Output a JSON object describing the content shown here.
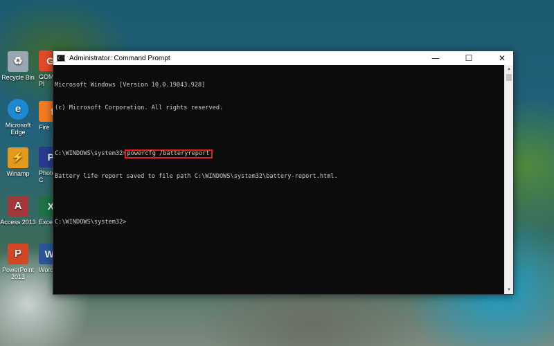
{
  "desktop": {
    "icons": [
      {
        "name": "recycle-bin",
        "label": "Recycle Bin",
        "glyph": "♻",
        "color": "#9aa7b3"
      },
      {
        "name": "microsoft-edge",
        "label": "Microsoft Edge",
        "glyph": "e",
        "color": "#1b8ad3"
      },
      {
        "name": "winamp",
        "label": "Winamp",
        "glyph": "⚡",
        "color": "#e59a1e"
      },
      {
        "name": "access-2013",
        "label": "Access 2013",
        "glyph": "A",
        "color": "#a4373a"
      },
      {
        "name": "powerpoint-2013",
        "label": "PowerPoint 2013",
        "glyph": "P",
        "color": "#d24726"
      }
    ],
    "partial_icons": [
      {
        "name": "gom-player",
        "label": "GOM",
        "label2": "Pl",
        "glyph": "G",
        "color": "#e14b2a"
      },
      {
        "name": "firefox",
        "label": "Fire",
        "glyph": "f",
        "color": "#f57b21"
      },
      {
        "name": "photoshop",
        "label": "Photo",
        "label2": "C",
        "glyph": "P",
        "color": "#2a3b8f"
      },
      {
        "name": "excel",
        "label": "Excel",
        "glyph": "X",
        "color": "#1f7244"
      },
      {
        "name": "word",
        "label": "Word",
        "glyph": "W",
        "color": "#2b579a"
      }
    ]
  },
  "window": {
    "title": "Administrator: Command Prompt",
    "icon_text": "C:\\",
    "minimize": "—",
    "maximize": "☐",
    "close": "✕"
  },
  "console": {
    "line1": "Microsoft Windows [Version 10.0.19043.928]",
    "line2": "(c) Microsoft Corporation. All rights reserved.",
    "prompt1": "C:\\WINDOWS\\system32>",
    "command": "powercfg /batteryreport",
    "output": "Battery life report saved to file path C:\\WINDOWS\\system32\\battery-report.html.",
    "prompt2": "C:\\WINDOWS\\system32>"
  },
  "colors": {
    "console_bg": "#0c0c0c",
    "console_fg": "#cccccc",
    "highlight": "#e02020"
  }
}
